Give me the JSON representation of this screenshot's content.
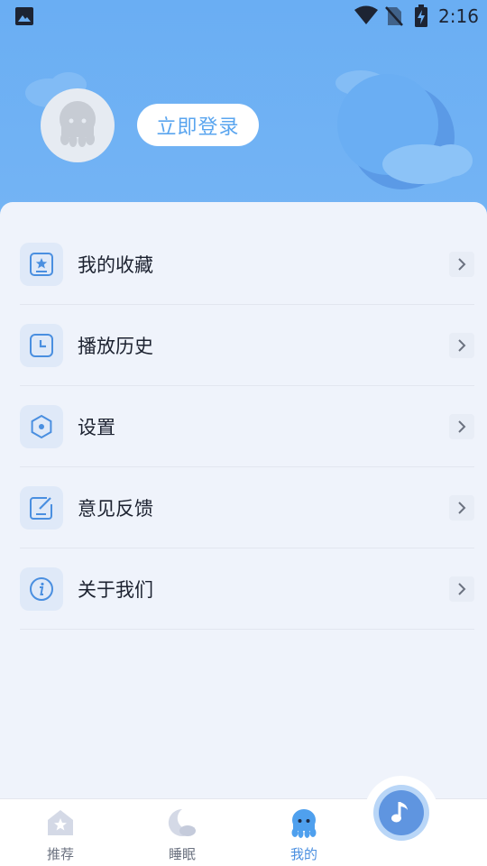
{
  "status_bar": {
    "time": "2:16",
    "icons": [
      "gallery-icon",
      "wifi-icon",
      "no-sim-icon",
      "battery-charging-icon"
    ]
  },
  "profile": {
    "login_label": "立即登录",
    "avatar_icon": "octopus-avatar-icon"
  },
  "menu": {
    "items": [
      {
        "label": "我的收藏",
        "icon": "favorites-icon"
      },
      {
        "label": "播放历史",
        "icon": "history-icon"
      },
      {
        "label": "设置",
        "icon": "settings-icon"
      },
      {
        "label": "意见反馈",
        "icon": "feedback-icon"
      },
      {
        "label": "关于我们",
        "icon": "info-icon"
      }
    ]
  },
  "tabbar": {
    "tabs": [
      {
        "label": "推荐",
        "icon": "home-icon",
        "active": false
      },
      {
        "label": "睡眠",
        "icon": "moon-icon",
        "active": false
      },
      {
        "label": "我的",
        "icon": "octopus-icon",
        "active": true
      }
    ],
    "player_icon": "music-note-icon"
  },
  "colors": {
    "header": "#6aaef3",
    "accent": "#4a8fe0",
    "background": "#eef2fb",
    "login_text": "#5aa5ef"
  }
}
